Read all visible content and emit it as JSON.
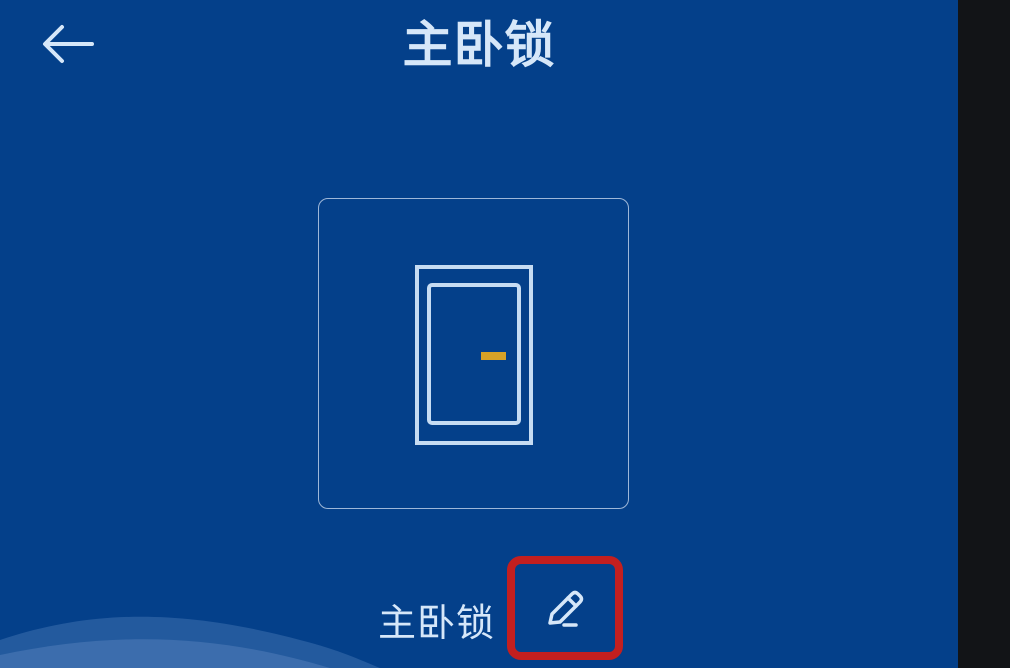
{
  "header": {
    "title": "主卧锁",
    "back_icon": "back-arrow-icon"
  },
  "device": {
    "icon": "door-lock-icon",
    "name": "主卧锁",
    "edit_icon": "pencil-icon"
  },
  "colors": {
    "background": "#04408a",
    "text": "#d6e7f9",
    "card_border": "#9eb7d8",
    "door_handle": "#d7a227",
    "highlight_border": "#c31f1f"
  }
}
